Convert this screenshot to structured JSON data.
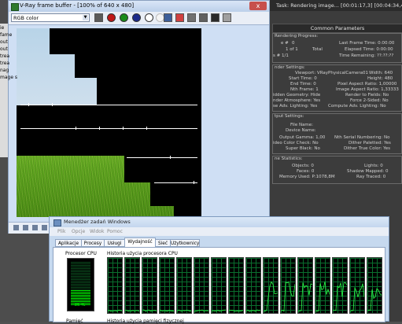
{
  "vfb": {
    "title": "V-Ray frame buffer - [100% of 640 x 480]",
    "channel": "RGB color",
    "close_label": "x"
  },
  "render_progress": {
    "title": "Task:      Rendering image... [00:01:17,3] [00:04:34,4 est]",
    "common_parameters": "Common Parameters",
    "rendering_progress": "Rendering Progress:",
    "frame_label": "e #",
    "frame_value": "0",
    "of_label": "1 of 1",
    "total_label": "Total",
    "last_frame_time": "Last Frame Time:   0:00:00",
    "elapsed_time": "Elapsed Time:   0:00:00",
    "time_remaining": "Time Remaining:   ??:??:??",
    "passes": "s #  1/1",
    "render_settings": "nder Settings:",
    "viewport": "Viewport:  VRayPhysicalCamera01",
    "width": "Width: 640",
    "start_time": "Start Time:  0",
    "height": "Height: 480",
    "end_time": "End Time:  0",
    "pixel_aspect": "Pixel Aspect Ratio: 1,00000",
    "nth_frame": "Nth Frame:  1",
    "image_aspect": "Image Aspect Ratio: 1,33333",
    "hidden_geometry": "idden Geometry:  Hide",
    "render_to_fields": "Render to Fields:  No",
    "render_atmosphere": "nder Atmosphere:  Yes",
    "force_2sided": "Force 2-Sided:  No",
    "use_adv_lighting": "se Adv. Lighting:  Yes",
    "compute_adv_lighting": "Compute Adv. Lighting:  No",
    "output_settings": "tput Settings:",
    "file_name": "File Name:",
    "device_name": "Device Name:",
    "output_gamma": "Output Gamma:  1,00",
    "nth_serial": "Nth Serial Numbering:  No",
    "color_check": "ideo Color Check:  No",
    "dither_paletted": "Dither Paletted:  Yes",
    "super_black": "Super Black:  No",
    "dither_true_color": "Dither True Color:  Yes",
    "scene_statistics": "ne Statistics:",
    "objects": "Objects:  0",
    "lights": "Lights:  0",
    "faces": "Faces:  0",
    "shadow_mapped": "Shadow Mapped:  0",
    "memory_used": "Memory Used:  P:1078,8M",
    "ray_traced": "Ray Traced:  0"
  },
  "left_panel": [
    "ie",
    "fame",
    "out",
    "out",
    "trea",
    "trea",
    "nag",
    "mage se"
  ],
  "task_manager": {
    "title": "Menedżer zadań Windows",
    "menus": [
      "Plik",
      "Opcje",
      "Widok",
      "Pomoc"
    ],
    "tabs": [
      "Aplikacje",
      "Procesy",
      "Usługi",
      "Wydajność",
      "Sieć",
      "Użytkownicy"
    ],
    "active_tab": "Wydajność",
    "cpu_label": "Procesor CPU",
    "cpu_usage_percent": 35,
    "cpu_usage_text": "35 %",
    "cpu_history_label": "Historia użycia procesora CPU",
    "memory_label": "Pamięć",
    "memory_history_label": "Historia użycia pamięci fizycznej",
    "graph_count": 16
  },
  "colors": {
    "grass": "#5ea41f",
    "sky": "#c9dcec",
    "meter_green": "#00ff00"
  }
}
